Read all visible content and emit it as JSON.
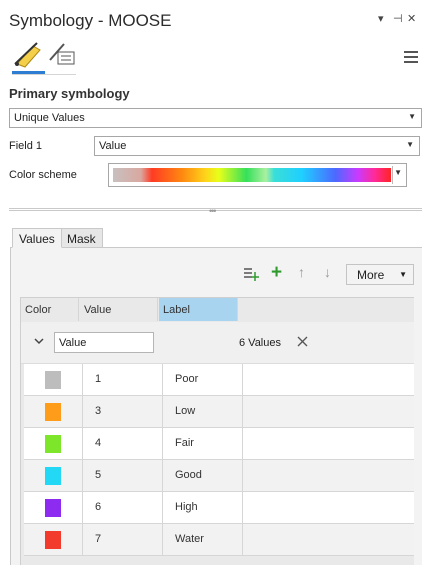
{
  "pane": {
    "title": "Symbology - MOOSE"
  },
  "window_controls": {
    "collapse": "▾",
    "pin": "⊣",
    "close": "✕"
  },
  "primary": {
    "heading": "Primary symbology",
    "method": "Unique Values",
    "field1_label": "Field 1",
    "field1_value": "Value",
    "color_scheme_label": "Color scheme"
  },
  "tabs": [
    {
      "label": "Values",
      "active": true
    },
    {
      "label": "Mask",
      "active": false
    }
  ],
  "toolbar": {
    "add": "+",
    "up": "↑",
    "down": "↓",
    "more_label": "More"
  },
  "grid": {
    "columns": [
      "Color",
      "Value",
      "Label"
    ],
    "group_field": "Value",
    "group_count": "6 Values",
    "rows": [
      {
        "color": "#bdbdbd",
        "value": "1",
        "label": "Poor"
      },
      {
        "color": "#ff9d1a",
        "value": "3",
        "label": "Low"
      },
      {
        "color": "#7ee62a",
        "value": "4",
        "label": "Fair"
      },
      {
        "color": "#22d8f5",
        "value": "5",
        "label": "Good"
      },
      {
        "color": "#8d2bf0",
        "value": "6",
        "label": "High"
      },
      {
        "color": "#f23b2d",
        "value": "7",
        "label": "Water"
      }
    ]
  },
  "icons": [
    "symbology-tab-icon",
    "vary-symbology-tab-icon",
    "menu-icon",
    "add-all-values-icon",
    "add-value-icon",
    "move-up-icon",
    "move-down-icon",
    "collapse-group-icon",
    "remove-group-icon"
  ]
}
